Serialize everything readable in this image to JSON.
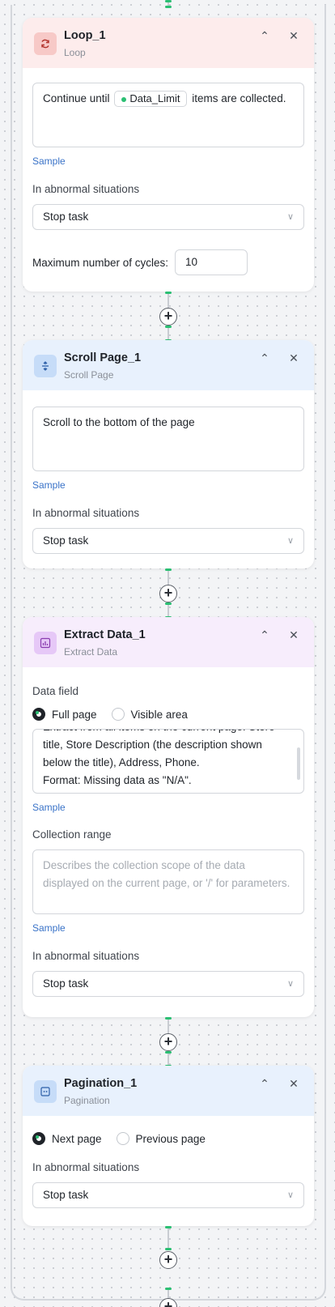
{
  "colors": {
    "accent_green": "#2bbf73",
    "link_blue": "#3a73c8"
  },
  "loop": {
    "title": "Loop_1",
    "subtitle": "Loop",
    "icon": "loop-icon",
    "text_before": "Continue until",
    "chip": "Data_Limit",
    "text_after": "items are collected.",
    "sample": "Sample",
    "abnormal_label": "In abnormal situations",
    "abnormal_value": "Stop task",
    "max_cycles_label": "Maximum number of cycles:",
    "max_cycles_value": "10"
  },
  "scroll": {
    "title": "Scroll Page_1",
    "subtitle": "Scroll Page",
    "icon": "scroll-icon",
    "text": "Scroll to the bottom of the page",
    "sample": "Sample",
    "abnormal_label": "In abnormal situations",
    "abnormal_value": "Stop task"
  },
  "extract": {
    "title": "Extract Data_1",
    "subtitle": "Extract Data",
    "icon": "extract-chart-icon",
    "data_field_label": "Data field",
    "radio_full": "Full page",
    "radio_visible": "Visible area",
    "text_line0": "Extract from all items on the current page: Store",
    "text_line1": "title, Store Description (the description shown",
    "text_line2": "below the title), Address, Phone.",
    "text_line3": "Format: Missing data as \"N/A\".",
    "sample": "Sample",
    "range_label": "Collection range",
    "range_placeholder": "Describes the collection scope of the data displayed on the current page, or '/' for parameters.",
    "sample2": "Sample",
    "abnormal_label": "In abnormal situations",
    "abnormal_value": "Stop task"
  },
  "pagination": {
    "title": "Pagination_1",
    "subtitle": "Pagination",
    "icon": "pagination-icon",
    "radio_next": "Next page",
    "radio_prev": "Previous page",
    "abnormal_label": "In abnormal situations",
    "abnormal_value": "Stop task"
  },
  "icons": {
    "collapse": "chevron-up-icon",
    "close": "close-icon",
    "add": "plus-icon",
    "dropdown": "chevron-down-icon"
  }
}
